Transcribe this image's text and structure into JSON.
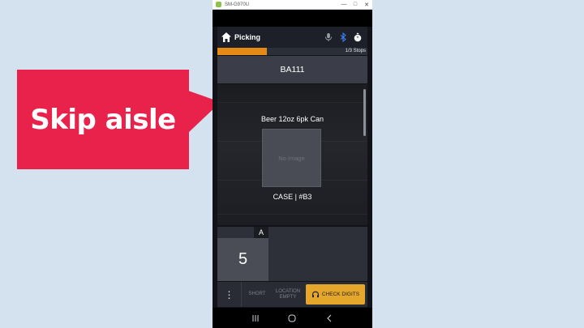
{
  "callout": {
    "text": "Skip aisle",
    "color": "#e8224a"
  },
  "window": {
    "title": "SM-G970U",
    "app_icon": "android-icon"
  },
  "header": {
    "title": "Picking",
    "icons": [
      "home-icon",
      "microphone-icon",
      "bluetooth-icon",
      "stopwatch-icon"
    ]
  },
  "progress": {
    "label": "1/3 Stops",
    "fraction": 0.33,
    "color": "#e58a15"
  },
  "location": {
    "code": "BA111"
  },
  "product": {
    "name": "Beer 12oz 6pk Can",
    "image_placeholder": "No Image",
    "uom": "CASE | #B3"
  },
  "quantity": {
    "value": "5",
    "letter": "A"
  },
  "actions": {
    "menu_icon": "more-vertical-icon",
    "short_label": "SHORT",
    "location_empty_label_1": "LOCATION",
    "location_empty_label_2": "EMPTY",
    "check_digits_label": "CHECK DIGITS",
    "check_digits_icon": "headset-icon",
    "accent": "#e4a62b"
  },
  "navbar": {
    "icons": [
      "recents-icon",
      "home-circle-icon",
      "back-icon"
    ]
  }
}
